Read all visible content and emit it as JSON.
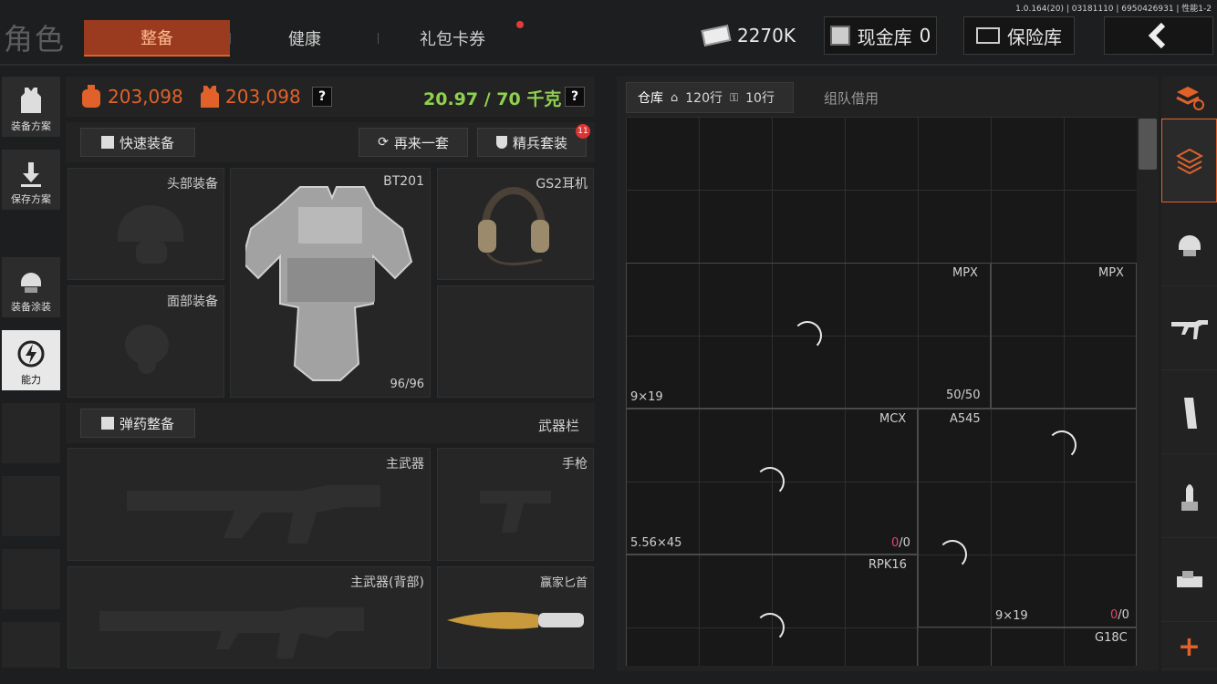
{
  "version": "1.0.164(20) | 03181110 | 6950426931 | 性能1-2",
  "title": "角色",
  "tabs": [
    {
      "label": "整备"
    },
    {
      "label": "健康"
    },
    {
      "label": "礼包卡券"
    }
  ],
  "topbar": {
    "money": "2270K",
    "cash_label": "现金库",
    "cash_value": "0",
    "safe_label": "保险库"
  },
  "sidebar": [
    {
      "label": "装备方案"
    },
    {
      "label": "保存方案"
    },
    {
      "label": "装备涂装"
    },
    {
      "label": "能力"
    }
  ],
  "stats": {
    "value1": "203,098",
    "value2": "203,098",
    "weight": "20.97 / 70 千克",
    "help": "?"
  },
  "actions": {
    "quick": "快速装备",
    "again": "再来一套",
    "elite": "精兵套装",
    "elite_badge": "11"
  },
  "slots": {
    "head": "头部装备",
    "face": "面部装备",
    "armor_name": "BT201",
    "armor_dur": "96/96",
    "headset": "GS2耳机"
  },
  "ammo": {
    "btn": "弹药整备",
    "weapon_bar": "武器栏"
  },
  "weapons": {
    "primary": "主武器",
    "pistol": "手枪",
    "back": "主武器(背部)",
    "melee": "赢家匕首"
  },
  "warehouse": {
    "tab": "仓库",
    "rows_house": "120行",
    "rows_key": "10行",
    "team": "组队借用"
  },
  "grid": {
    "mpx1": "MPX",
    "mpx2": "MPX",
    "cal1": "9×19",
    "count1": "50/50",
    "mcx": "MCX",
    "a545": "A545",
    "cal2": "5.56×45",
    "count2a": "0",
    "count2b": "/0",
    "rpk": "RPK16",
    "cal3": "9×19",
    "count3a": "0",
    "count3b": "/0",
    "g18c": "G18C"
  },
  "colors": {
    "accent": "#e0622a",
    "weight": "#8fd14f",
    "alert": "#e2456a"
  }
}
